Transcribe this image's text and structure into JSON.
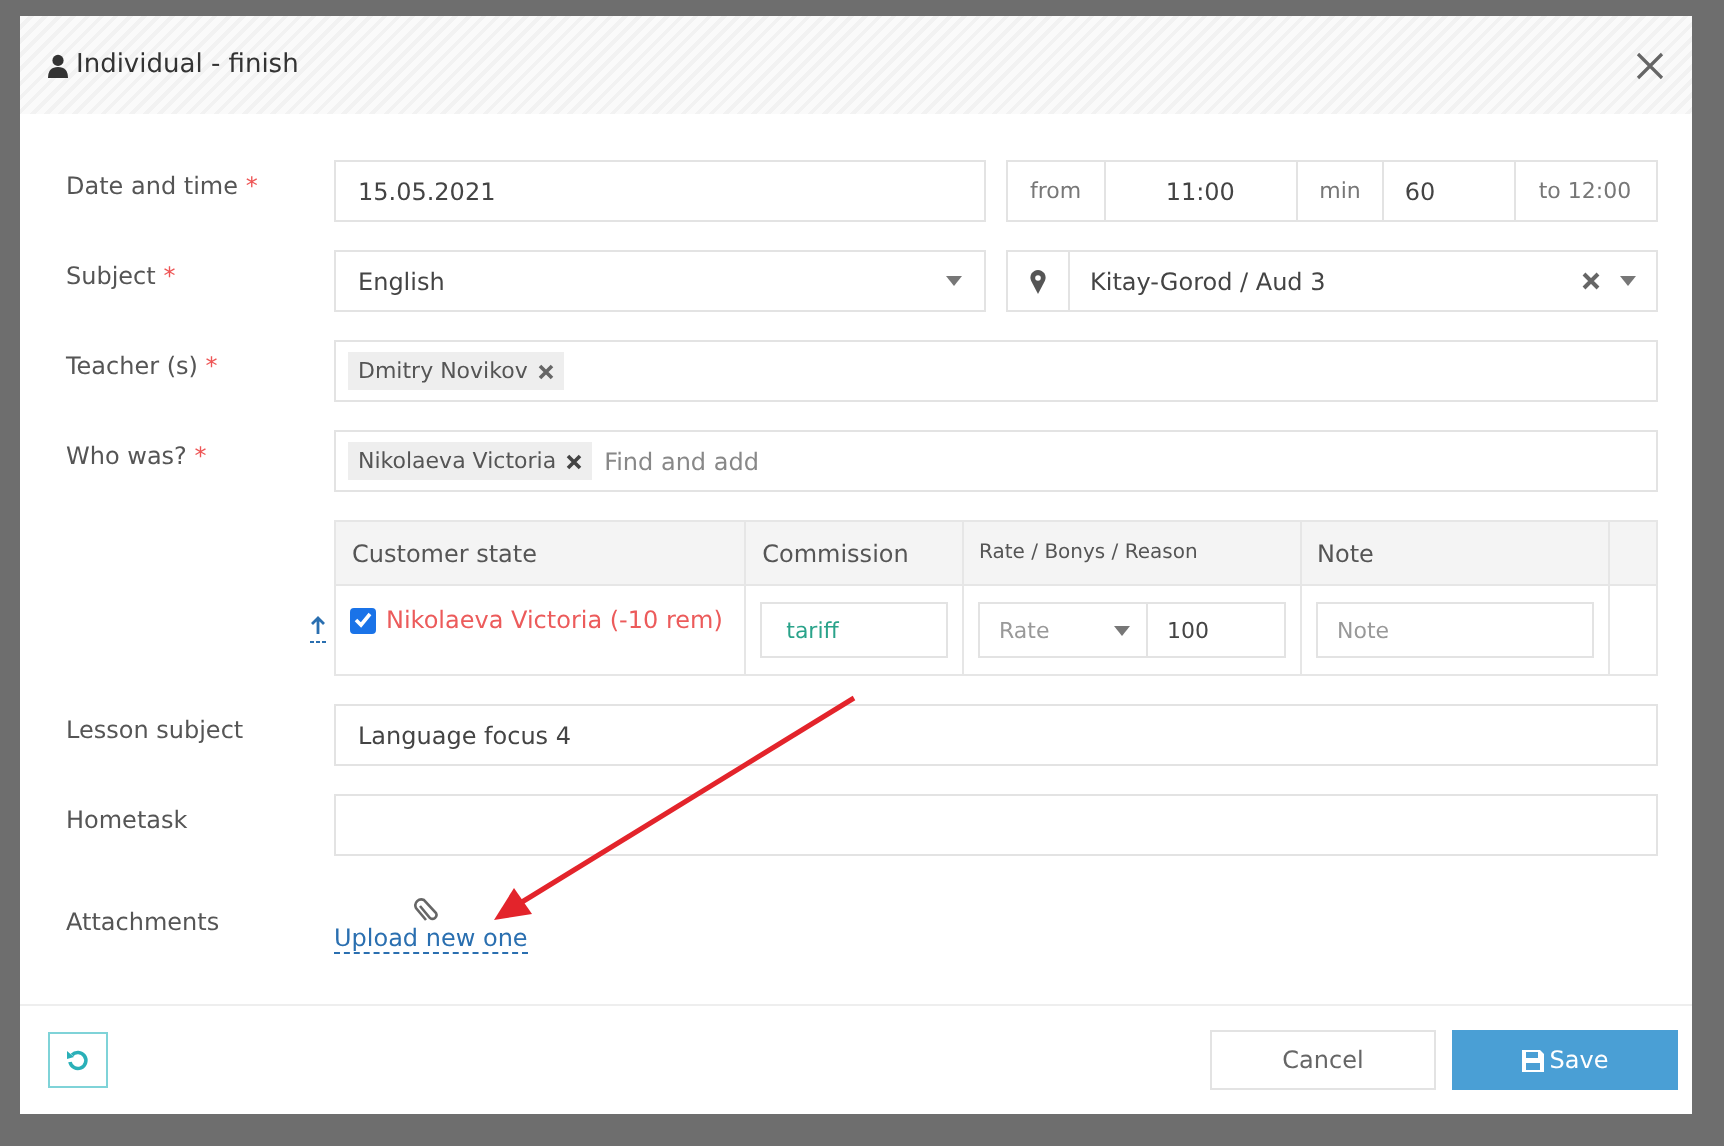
{
  "dialog": {
    "title": "Individual - finish"
  },
  "date_time": {
    "label": "Date and time",
    "required_mark": "*",
    "date": "15.05.2021",
    "from_label": "from",
    "from": "11:00",
    "min_label": "min",
    "min": "60",
    "to": "to 12:00"
  },
  "subject": {
    "label": "Subject",
    "required_mark": "*",
    "value": "English"
  },
  "location": {
    "value": "Kitay-Gorod / Aud 3"
  },
  "teachers": {
    "label": "Teacher (s)",
    "required_mark": "*",
    "tags": [
      "Dmitry Novikov"
    ]
  },
  "who_was": {
    "label": "Who was?",
    "required_mark": "*",
    "tags": [
      "Nikolaeva Victoria"
    ],
    "placeholder": "Find and add"
  },
  "attendance_table": {
    "columns": [
      "Customer state",
      "Commission",
      "Rate / Bonys / Reason",
      "Note"
    ],
    "rows": [
      {
        "checked": true,
        "name": "Nikolaeva Victoria (-10 rem)",
        "commission": "tariff",
        "rate_placeholder": "Rate",
        "amount": "100",
        "note_placeholder": "Note"
      }
    ]
  },
  "lesson_subject": {
    "label": "Lesson subject",
    "value": "Language focus 4"
  },
  "hometask": {
    "label": "Hometask"
  },
  "attachments": {
    "label": "Attachments",
    "link": "Upload new one"
  },
  "footer": {
    "cancel": "Cancel",
    "save": "Save"
  }
}
